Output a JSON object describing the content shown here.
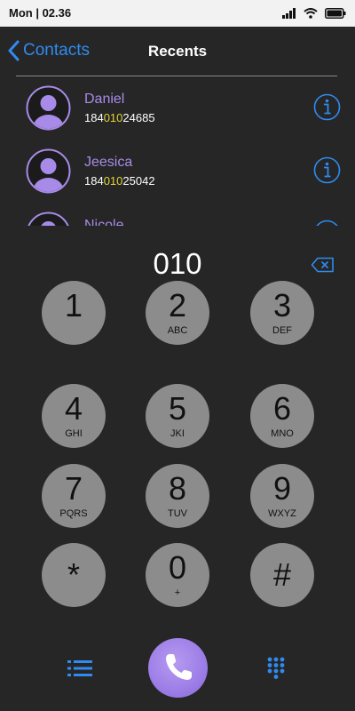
{
  "status_bar": {
    "time": "Mon | 02.36",
    "icons": [
      "signal-icon",
      "wifi-icon",
      "battery-icon"
    ]
  },
  "nav": {
    "back_label": "Contacts",
    "title": "Recents"
  },
  "recents": [
    {
      "name": "Daniel",
      "number_prefix": "184",
      "number_match": "010",
      "number_suffix": "24685"
    },
    {
      "name": "Jeesica",
      "number_prefix": "184",
      "number_match": "010",
      "number_suffix": "25042"
    },
    {
      "name": "Nicole",
      "number_prefix": "",
      "number_match": "",
      "number_suffix": ""
    }
  ],
  "dialer": {
    "display": "010",
    "keys": [
      {
        "digit": "1",
        "letters": ""
      },
      {
        "digit": "2",
        "letters": "ABC"
      },
      {
        "digit": "3",
        "letters": "DEF"
      },
      {
        "digit": "4",
        "letters": "GHI"
      },
      {
        "digit": "5",
        "letters": "JKI"
      },
      {
        "digit": "6",
        "letters": "MNO"
      },
      {
        "digit": "7",
        "letters": "PQRS"
      },
      {
        "digit": "8",
        "letters": "TUV"
      },
      {
        "digit": "9",
        "letters": "WXYZ"
      },
      {
        "digit": "*",
        "letters": ""
      },
      {
        "digit": "0",
        "letters": "+"
      },
      {
        "digit": "#",
        "letters": ""
      }
    ]
  },
  "colors": {
    "background": "#262626",
    "accent_blue": "#2f8bf0",
    "contact_name": "#a88be8",
    "number_highlight": "#e3d43a",
    "key_fill": "#8c8c8c",
    "call_button": "#a084ea",
    "status_bar": "#f2f2f2"
  },
  "toolbar": {
    "icons": [
      "list-icon",
      "phone-icon",
      "keypad-icon"
    ]
  }
}
